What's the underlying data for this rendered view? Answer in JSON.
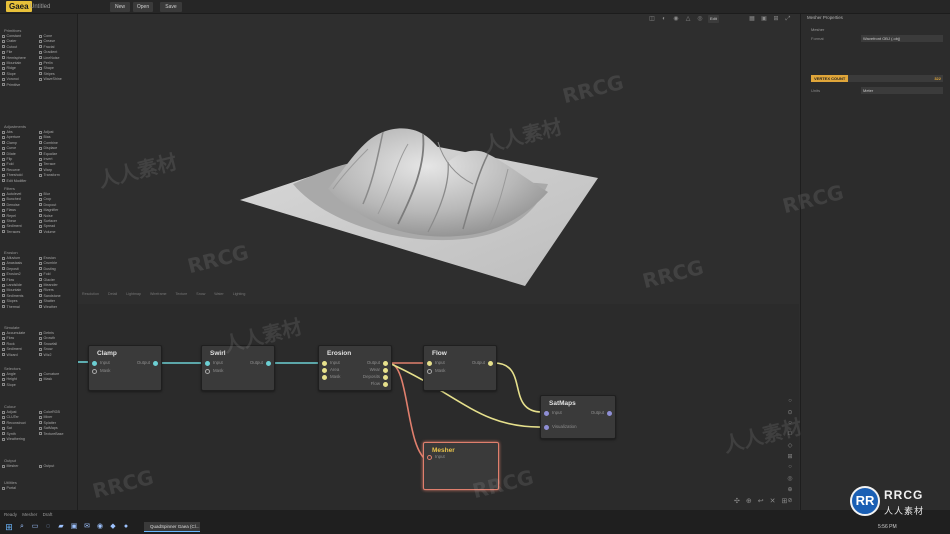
{
  "app": {
    "logo": "Gaea",
    "project": "Untitled"
  },
  "toolbar": {
    "new_label": "New",
    "open_label": "Open",
    "save_label": "Save",
    "undo_glyph": "↶"
  },
  "left_panel": {
    "sections": [
      {
        "title": "Primitives",
        "items": [
          "Constant",
          "Cone",
          "Crater",
          "Crease",
          "Cutout",
          "Fractal",
          "File",
          "Gradient",
          "Hemisphere",
          "LineNoise",
          "Mountain",
          "Perlin",
          "Ridge",
          "Shape",
          "Slope",
          "Stripes",
          "Voronoi",
          "WaveShine",
          "Primitive"
        ]
      },
      {
        "title": "Adjustments",
        "items": [
          "Abs",
          "Adjust",
          "Aperture",
          "Bias",
          "Clamp",
          "Combine",
          "Curve",
          "Displace",
          "Dilate",
          "Equalize",
          "Flip",
          "Invert",
          "Fold",
          "Terrace",
          "Recurve",
          "Warp",
          "Threshold",
          "Transform",
          "Edit Modifier"
        ]
      },
      {
        "title": "Filters",
        "items": [
          "Autolevel",
          "Blur",
          "Bunched",
          "Crop",
          "Denoise",
          "Dropout",
          "Flaws",
          "Magnifier",
          "Repel",
          "Noise",
          "Shear",
          "Surfacer",
          "Sediment",
          "Spread",
          "Terraces",
          "Volume"
        ]
      },
      {
        "title": "Erosion",
        "items": [
          "Alluvium",
          "Erosion",
          "Anastasis",
          "Crumble",
          "Deposit",
          "Dusting",
          "Erosion2",
          "Fold",
          "Flow",
          "Glacier",
          "Landslide",
          "Meander",
          "Mountain",
          "Rivers",
          "Sediments",
          "Sandstone",
          "Slopes",
          "Shatter",
          "Thermal",
          "Weather"
        ]
      },
      {
        "title": "Simulate",
        "items": [
          "Accumulate",
          "Debris",
          "Flow",
          "Growth",
          "Rock",
          "Snowfall",
          "Sediment",
          "Snow",
          "Wizard",
          "Wiz2"
        ]
      },
      {
        "title": "Selectors",
        "items": [
          "Angle",
          "Curvature",
          "Height",
          "Mask",
          "Slope"
        ]
      },
      {
        "title": "Colour",
        "items": [
          "Adjust",
          "ColorRGB",
          "CLUTer",
          "Mixer",
          "Reconstruct",
          "Splatter",
          "Sat",
          "SatMaps",
          "Synth",
          "TextureBase",
          "Weathering"
        ]
      },
      {
        "title": "Output",
        "items": [
          "Mesher",
          "Output"
        ]
      },
      {
        "title": "Utilities",
        "items": [
          "Portal"
        ]
      }
    ]
  },
  "viewport": {
    "icons": [
      "grid-icon",
      "sun-icon",
      "shading-icon",
      "light-icon",
      "color-icon",
      "layout-icon",
      "camera-icon"
    ],
    "mode_label": "Edit",
    "bottom_labels": [
      "Resolution",
      "Detail",
      "Lightmap",
      "Wireframe",
      "Texture",
      "Snow",
      "Water",
      "Lighting"
    ]
  },
  "graph": {
    "nodes": [
      {
        "id": "clamp",
        "title": "Clamp",
        "inputs": [
          "Input",
          "Mask"
        ],
        "outputs": [
          "Output"
        ]
      },
      {
        "id": "swirl",
        "title": "Swirl",
        "inputs": [
          "Input",
          "Mask"
        ],
        "outputs": [
          "Output"
        ]
      },
      {
        "id": "erosion",
        "title": "Erosion",
        "inputs": [
          "Input",
          "Area",
          "Mask"
        ],
        "outputs": [
          "Output",
          "Wear",
          "Deposits",
          "Flow"
        ]
      },
      {
        "id": "flow",
        "title": "Flow",
        "inputs": [
          "Input",
          "Mask"
        ],
        "outputs": [
          "Output"
        ]
      },
      {
        "id": "satmaps",
        "title": "SatMaps",
        "inputs": [
          "Input",
          "Visualization"
        ],
        "outputs": [
          "Output"
        ]
      },
      {
        "id": "mesher",
        "title": "Mesher",
        "inputs": [
          "Input"
        ],
        "outputs": []
      }
    ],
    "tools": [
      "○",
      "⊙",
      "○",
      "□",
      "◇",
      "⊞",
      "○",
      "◎",
      "⊕",
      "⊘"
    ],
    "bottom_tools": [
      "✣",
      "⊕",
      "↩",
      "✕",
      "⊞"
    ]
  },
  "right_panel": {
    "title": "Mesher Properties",
    "section": "Mesher",
    "format_label": "Format",
    "format_value": "Wavefront OBJ (.obj)",
    "vertex_count_label": "VERTEX COUNT",
    "vertex_count_value": "322",
    "units_label": "Units",
    "units_value": "Meter"
  },
  "statusbar": {
    "state": "Ready",
    "mode": "Mesher",
    "quality": "Draft"
  },
  "taskbar": {
    "app_label": "QuadSpinner Gaea (Cl...",
    "clock": "5:56 PM"
  },
  "watermark": {
    "text_latin": "RRCG",
    "text_cn": "人人素材"
  },
  "brand": {
    "badge": "RR",
    "name": "RRCG",
    "sub": "人人素材"
  },
  "colors": {
    "accent": "#e8c13a",
    "wire_teal": "#6ccfd3",
    "wire_yellow": "#e6e08c",
    "wire_red": "#e07f6d",
    "wire_purple": "#8f8fd6"
  }
}
